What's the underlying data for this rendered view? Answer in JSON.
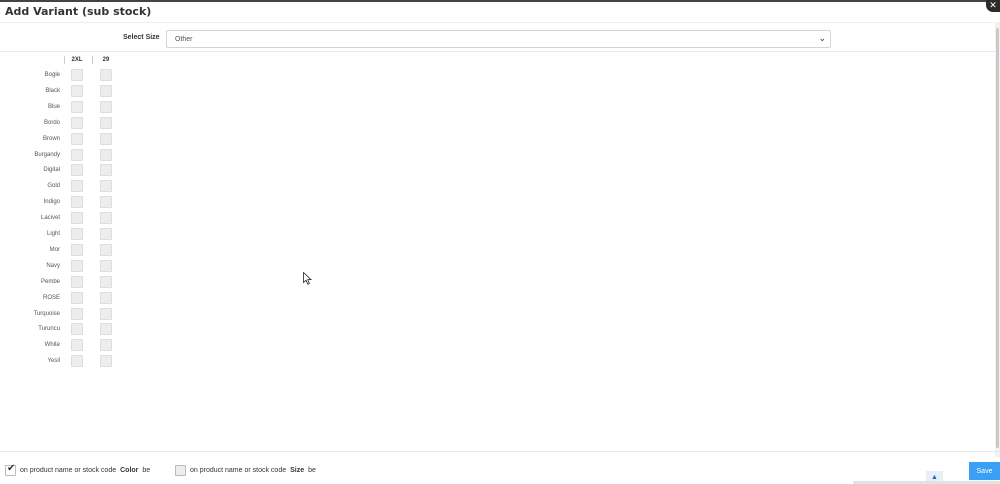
{
  "modal": {
    "title": "Add Variant (sub stock)",
    "close_icon": "close-icon",
    "close_glyph": "✕"
  },
  "size": {
    "label": "Select Size",
    "selected": "Other",
    "chevron_glyph": "⌄"
  },
  "grid": {
    "columns": [
      "2XL",
      "29"
    ],
    "rows": [
      "Bogle",
      "Black",
      "Blue",
      "Bordo",
      "Brown",
      "Burgandy",
      "Digital",
      "Gold",
      "Indigo",
      "Lacivet",
      "Light",
      "Mor",
      "Navy",
      "Pembe",
      "ROSE",
      "Turquoise",
      "Turuncu",
      "White",
      "Yesil"
    ]
  },
  "footer": {
    "color_option": {
      "prefix": "on product name or stock code",
      "bold": "Color",
      "suffix": "be",
      "checked": true
    },
    "size_option": {
      "prefix": "on product name or stock code",
      "bold": "Size",
      "suffix": "be",
      "checked": false
    },
    "save_label": "Save",
    "scroll_up_glyph": "▲",
    "check_glyph": "✔"
  },
  "colors": {
    "save_button": "#3a9ff5",
    "checkbox": "#ededed"
  }
}
